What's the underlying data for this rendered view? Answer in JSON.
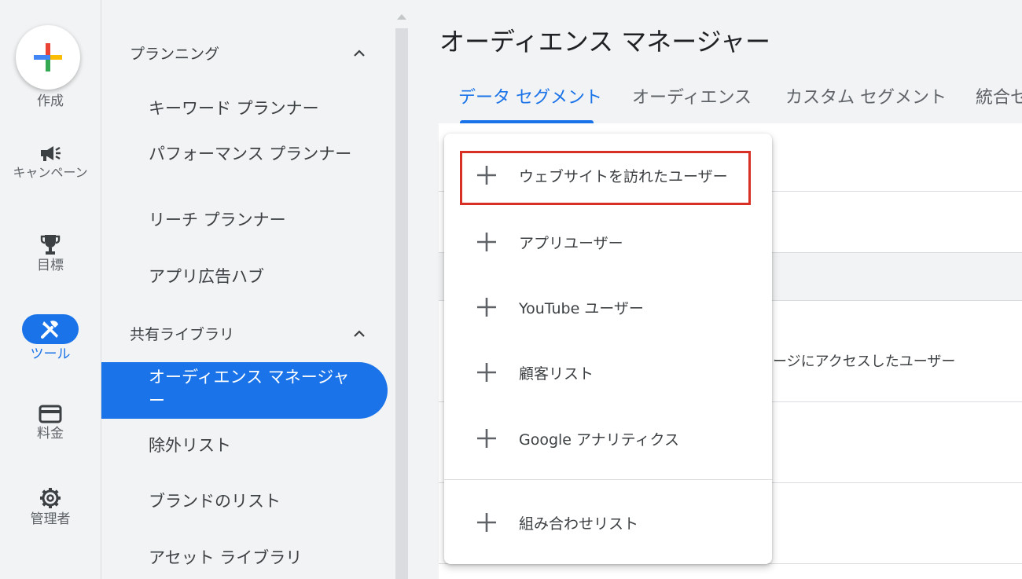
{
  "rail": {
    "create_label": "作成",
    "items": [
      {
        "label": "キャンペーン",
        "icon": "megaphone-icon"
      },
      {
        "label": "目標",
        "icon": "trophy-icon"
      },
      {
        "label": "ツール",
        "icon": "tools-icon"
      },
      {
        "label": "料金",
        "icon": "credit-card-icon"
      },
      {
        "label": "管理者",
        "icon": "gear-icon"
      }
    ]
  },
  "nav": {
    "sections": [
      {
        "label": "プランニング"
      },
      {
        "label": "共有ライブラリ"
      }
    ],
    "planning_items": [
      "キーワード プランナー",
      "パフォーマンス プランナー",
      "リーチ プランナー",
      "アプリ広告ハブ"
    ],
    "library_items": [
      "オーディエンス マネージャー",
      "除外リスト",
      "ブランドのリスト",
      "アセット ライブラリ"
    ]
  },
  "main": {
    "title": "オーディエンス マネージャー",
    "tabs": [
      "データ セグメント",
      "オーディエンス",
      "カスタム セグメント",
      "統合セ"
    ],
    "row_snippet": "ージにアクセスしたユーザー"
  },
  "menu": {
    "items": [
      "ウェブサイトを訪れたユーザー",
      "アプリユーザー",
      "YouTube ユーザー",
      "顧客リスト",
      "Google アナリティクス",
      "組み合わせリスト"
    ]
  },
  "colors": {
    "accent": "#1a73e8",
    "highlight": "#d93025"
  }
}
